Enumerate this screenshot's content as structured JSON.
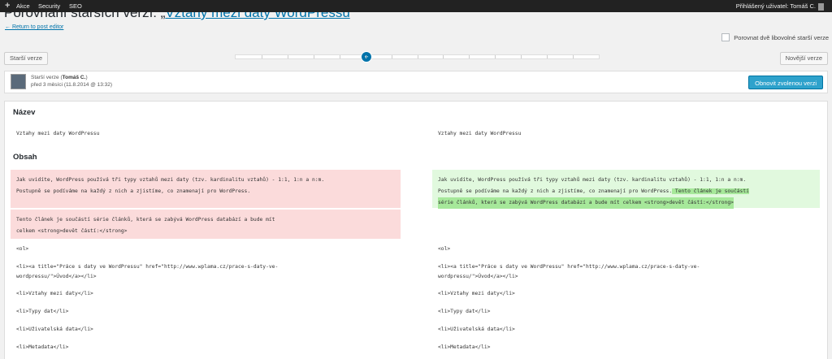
{
  "adminbar": {
    "plus": "+",
    "items": [
      "Akce",
      "Security",
      "SEO"
    ],
    "user": "Přihlášený uživatel: Tomáš C."
  },
  "header": {
    "title_prefix": "Porovnání starších verzí: „",
    "title_link": "Vztahy mezi daty WordPressu",
    "return_link": "← Return to post editor",
    "compare_two_label": "Porovnat dvě libovolné starší verze"
  },
  "nav": {
    "prev_label": "Starší verze",
    "next_label": "Novější verze",
    "slider_ticks": 14,
    "slider_position": 0.36
  },
  "meta": {
    "author_prefix": "Starší verze (",
    "author": "Tomáš C.",
    "author_suffix": ")",
    "date": "před 3 měsíci (11.8.2014 @ 13:32)",
    "restore_label": "Obnovit zvolenou verzi"
  },
  "diff": {
    "title_heading": "Název",
    "title_left": "Vztahy mezi daty WordPressu",
    "title_right": "Vztahy mezi daty WordPressu",
    "content_heading": "Obsah",
    "left_del_1a": "Jak uvidíte, WordPress používá tři typy vztahů mezi daty (tzv. kardinalitu vztahů) - 1:1, 1:n a n:m.",
    "left_del_1b": "Postupně se podíváme na každý z nich a zjistíme, co znamenají pro WordPress.",
    "left_del_2a": "Tento článek je součástí série článků, která se zabývá WordPress databází a bude mít",
    "left_del_2b": "celkem <strong>devět částí:</strong>",
    "right_ins_1a": "Jak uvidíte, WordPress používá tři typy vztahů mezi daty (tzv. kardinalitu vztahů) - 1:1, 1:n a n:m.",
    "right_ins_1b": "Postupně se podíváme na každý z nich a zjistíme, co znamenají pro WordPress.",
    "right_ins_1b_hl": " Tento článek je součástí",
    "right_ins_1c": "série článků, která se zabývá WordPress databází a bude mít celkem <strong>devět částí:</strong>",
    "lines": [
      "<ol>",
      " <li><a title=\"Práce s daty ve WordPressu\" href=\"http://www.wplama.cz/prace-s-daty-ve-",
      "wordpressu/\">Úvod</a></li>",
      " <li>Vztahy mezi daty</li>",
      " <li>Typy dat</li>",
      " <li>Uživatelská data</li>",
      " <li>Metadata</li>"
    ]
  }
}
